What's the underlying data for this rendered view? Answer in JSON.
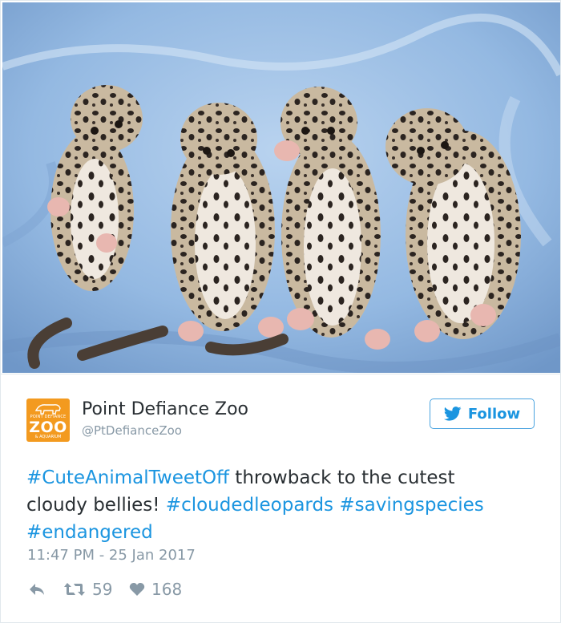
{
  "account": {
    "name": "Point Defiance Zoo",
    "handle": "@PtDefianceZoo",
    "logo": {
      "top_text": "POINT DEFIANCE",
      "main_text": "ZOO",
      "bottom_text": "& AQUARIUM",
      "color": "#f39a1f"
    }
  },
  "follow_button": {
    "label": "Follow",
    "icon": "twitter-bird-icon",
    "color": "#1b95e0"
  },
  "tweet": {
    "line1": {
      "hashtag": "#CuteAnimalTweetOff",
      "text": " throwback to the cutest"
    },
    "line2": {
      "text": "cloudy bellies! ",
      "hashtag1": "#cloudedleopards",
      "space": " ",
      "hashtag2": "#savingspecies"
    },
    "line3": {
      "hashtag": "#endangered"
    },
    "timestamp": "11:47 PM - 25 Jan 2017"
  },
  "actions": {
    "reply_icon": "reply-arrow-icon",
    "retweet_icon": "retweet-icon",
    "retweet_count": "59",
    "like_icon": "heart-icon",
    "like_count": "168"
  },
  "colors": {
    "link": "#1b95e0",
    "muted": "#8899a6",
    "text": "#292f33",
    "photo_background": "#8fb7e2"
  }
}
